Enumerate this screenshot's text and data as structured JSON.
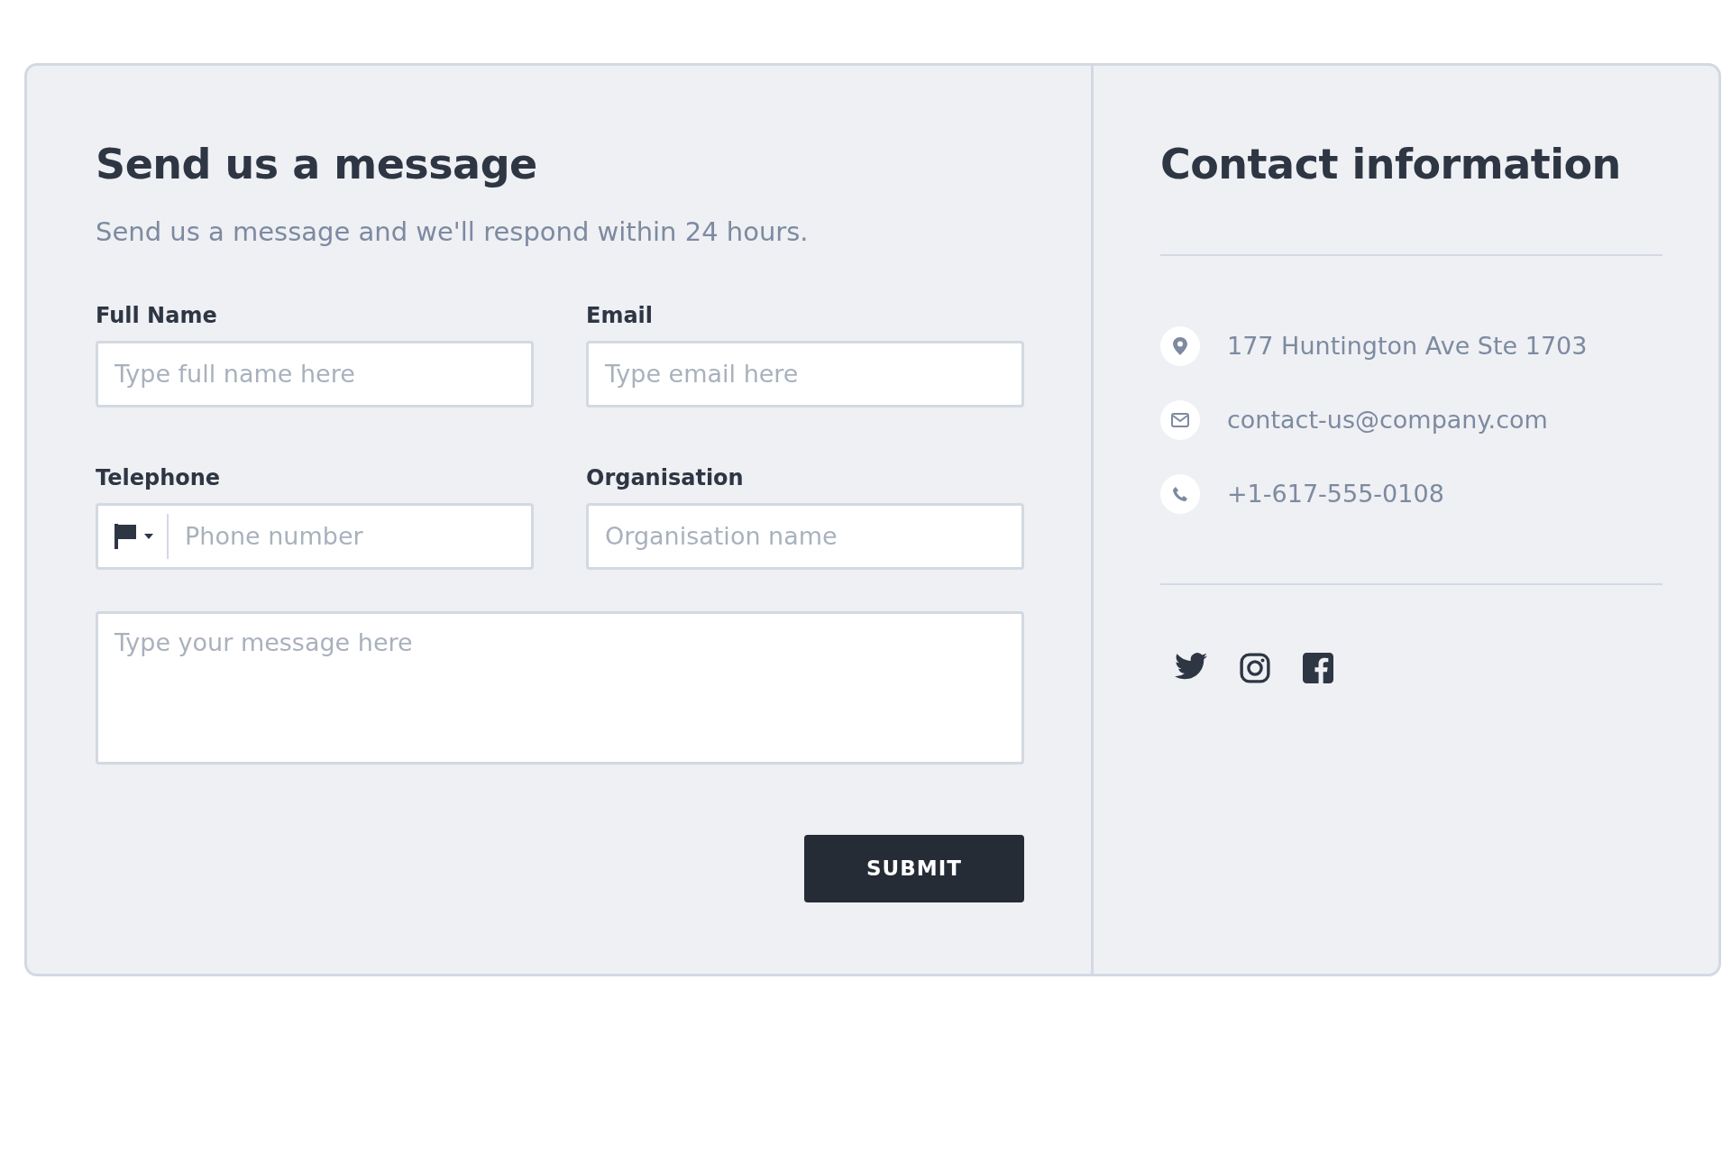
{
  "form": {
    "title": "Send us a message",
    "subtitle": "Send us a message and we'll respond within 24 hours.",
    "fields": [
      {
        "kind": "text",
        "label": "Full Name",
        "placeholder": "Type full name here"
      },
      {
        "kind": "text",
        "label": "Email",
        "placeholder": "Type email here"
      },
      {
        "kind": "phone",
        "label": "Telephone",
        "placeholder": "Phone number"
      },
      {
        "kind": "text",
        "label": "Organisation",
        "placeholder": "Organisation name"
      },
      {
        "kind": "textarea",
        "placeholder": "Type your message here"
      }
    ],
    "submit": "SUBMIT"
  },
  "contact": {
    "title": "Contact information",
    "items": [
      {
        "kind": "address",
        "text": "177 Huntington Ave Ste 1703"
      },
      {
        "kind": "email",
        "text": "contact-us@company.com"
      },
      {
        "kind": "phone",
        "text": "+1-617-555-0108"
      }
    ],
    "social": [
      {
        "kind": "bird"
      },
      {
        "kind": "camera"
      },
      {
        "kind": "square"
      }
    ]
  }
}
